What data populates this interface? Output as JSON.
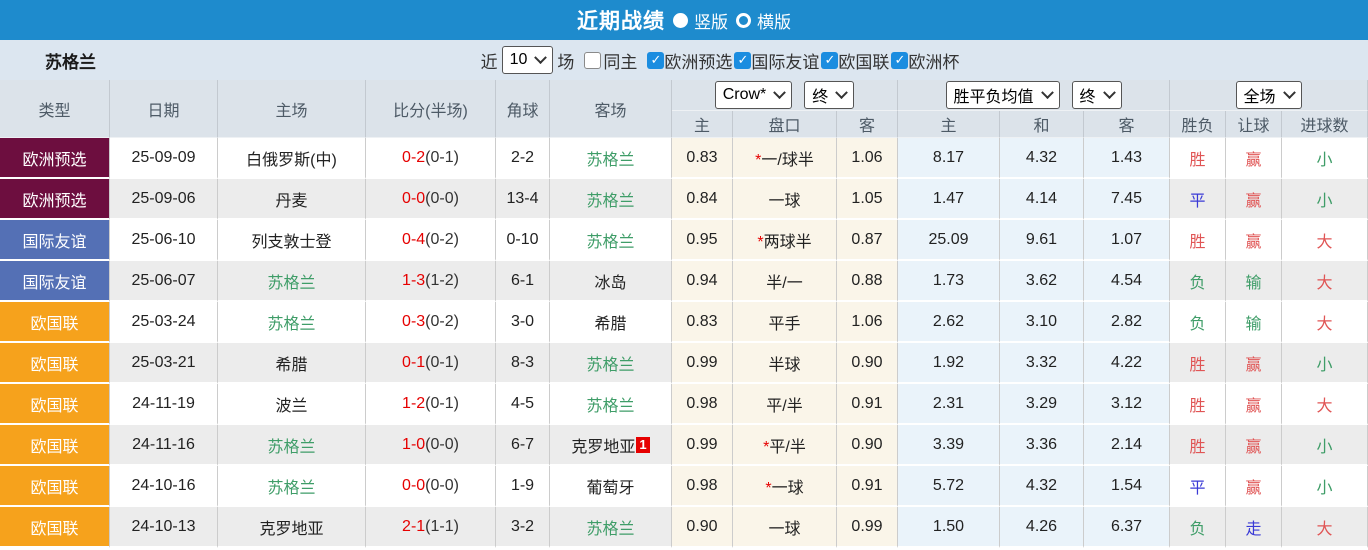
{
  "topbar": {
    "title": "近期战绩",
    "radios": [
      {
        "label": "竖版",
        "selected": true
      },
      {
        "label": "横版",
        "selected": false
      }
    ]
  },
  "filterbar": {
    "team": "苏格兰",
    "recent_label": "近",
    "recent_value": "10",
    "games_label": "场",
    "same_home_label": "同主",
    "same_home_checked": false,
    "competitions": [
      {
        "label": "欧洲预选",
        "checked": true
      },
      {
        "label": "国际友谊",
        "checked": true
      },
      {
        "label": "欧国联",
        "checked": true
      },
      {
        "label": "欧洲杯",
        "checked": true
      }
    ],
    "check_glyph": "✓"
  },
  "table": {
    "headers": {
      "type": "类型",
      "date": "日期",
      "home": "主场",
      "score": "比分(半场)",
      "corner": "角球",
      "away": "客场",
      "odds_select": "Crow*",
      "odds_time_select": "终",
      "odds_sub": [
        "主",
        "盘口",
        "客"
      ],
      "mean_select": "胜平负均值",
      "mean_time_select": "终",
      "mean_sub": [
        "主",
        "和",
        "客"
      ],
      "scope_select": "全场",
      "result_sub": [
        "胜负",
        "让球",
        "进球数"
      ]
    },
    "rows": [
      {
        "type": "欧洲预选",
        "date": "25-09-09",
        "home": "白俄罗斯(中)",
        "home_team": false,
        "score_ft": "0-2",
        "score_ht": "(0-1)",
        "corner": "2-2",
        "away": "苏格兰",
        "away_team": true,
        "away_badge": "",
        "odds_home": "0.83",
        "handicap_star": true,
        "handicap": "一/球半",
        "odds_away": "1.06",
        "mean_home": "8.17",
        "mean_draw": "4.32",
        "mean_away": "1.43",
        "result": "胜",
        "result_color": "red",
        "let_result": "赢",
        "let_color": "red",
        "goals": "小",
        "goals_color": "green"
      },
      {
        "type": "欧洲预选",
        "date": "25-09-06",
        "home": "丹麦",
        "home_team": false,
        "score_ft": "0-0",
        "score_ht": "(0-0)",
        "corner": "13-4",
        "away": "苏格兰",
        "away_team": true,
        "away_badge": "",
        "odds_home": "0.84",
        "handicap_star": false,
        "handicap": "一球",
        "odds_away": "1.05",
        "mean_home": "1.47",
        "mean_draw": "4.14",
        "mean_away": "7.45",
        "result": "平",
        "result_color": "blue",
        "let_result": "赢",
        "let_color": "red",
        "goals": "小",
        "goals_color": "green"
      },
      {
        "type": "国际友谊",
        "date": "25-06-10",
        "home": "列支敦士登",
        "home_team": false,
        "score_ft": "0-4",
        "score_ht": "(0-2)",
        "corner": "0-10",
        "away": "苏格兰",
        "away_team": true,
        "away_badge": "",
        "odds_home": "0.95",
        "handicap_star": true,
        "handicap": "两球半",
        "odds_away": "0.87",
        "mean_home": "25.09",
        "mean_draw": "9.61",
        "mean_away": "1.07",
        "result": "胜",
        "result_color": "red",
        "let_result": "赢",
        "let_color": "red",
        "goals": "大",
        "goals_color": "red"
      },
      {
        "type": "国际友谊",
        "date": "25-06-07",
        "home": "苏格兰",
        "home_team": true,
        "score_ft": "1-3",
        "score_ht": "(1-2)",
        "corner": "6-1",
        "away": "冰岛",
        "away_team": false,
        "away_badge": "",
        "odds_home": "0.94",
        "handicap_star": false,
        "handicap": "半/一",
        "odds_away": "0.88",
        "mean_home": "1.73",
        "mean_draw": "3.62",
        "mean_away": "4.54",
        "result": "负",
        "result_color": "green",
        "let_result": "输",
        "let_color": "green",
        "goals": "大",
        "goals_color": "red"
      },
      {
        "type": "欧国联",
        "date": "25-03-24",
        "home": "苏格兰",
        "home_team": true,
        "score_ft": "0-3",
        "score_ht": "(0-2)",
        "corner": "3-0",
        "away": "希腊",
        "away_team": false,
        "away_badge": "",
        "odds_home": "0.83",
        "handicap_star": false,
        "handicap": "平手",
        "odds_away": "1.06",
        "mean_home": "2.62",
        "mean_draw": "3.10",
        "mean_away": "2.82",
        "result": "负",
        "result_color": "green",
        "let_result": "输",
        "let_color": "green",
        "goals": "大",
        "goals_color": "red"
      },
      {
        "type": "欧国联",
        "date": "25-03-21",
        "home": "希腊",
        "home_team": false,
        "score_ft": "0-1",
        "score_ht": "(0-1)",
        "corner": "8-3",
        "away": "苏格兰",
        "away_team": true,
        "away_badge": "",
        "odds_home": "0.99",
        "handicap_star": false,
        "handicap": "半球",
        "odds_away": "0.90",
        "mean_home": "1.92",
        "mean_draw": "3.32",
        "mean_away": "4.22",
        "result": "胜",
        "result_color": "red",
        "let_result": "赢",
        "let_color": "red",
        "goals": "小",
        "goals_color": "green"
      },
      {
        "type": "欧国联",
        "date": "24-11-19",
        "home": "波兰",
        "home_team": false,
        "score_ft": "1-2",
        "score_ht": "(0-1)",
        "corner": "4-5",
        "away": "苏格兰",
        "away_team": true,
        "away_badge": "",
        "odds_home": "0.98",
        "handicap_star": false,
        "handicap": "平/半",
        "odds_away": "0.91",
        "mean_home": "2.31",
        "mean_draw": "3.29",
        "mean_away": "3.12",
        "result": "胜",
        "result_color": "red",
        "let_result": "赢",
        "let_color": "red",
        "goals": "大",
        "goals_color": "red"
      },
      {
        "type": "欧国联",
        "date": "24-11-16",
        "home": "苏格兰",
        "home_team": true,
        "score_ft": "1-0",
        "score_ht": "(0-0)",
        "corner": "6-7",
        "away": "克罗地亚",
        "away_team": false,
        "away_badge": "1",
        "odds_home": "0.99",
        "handicap_star": true,
        "handicap": "平/半",
        "odds_away": "0.90",
        "mean_home": "3.39",
        "mean_draw": "3.36",
        "mean_away": "2.14",
        "result": "胜",
        "result_color": "red",
        "let_result": "赢",
        "let_color": "red",
        "goals": "小",
        "goals_color": "green"
      },
      {
        "type": "欧国联",
        "date": "24-10-16",
        "home": "苏格兰",
        "home_team": true,
        "score_ft": "0-0",
        "score_ht": "(0-0)",
        "corner": "1-9",
        "away": "葡萄牙",
        "away_team": false,
        "away_badge": "",
        "odds_home": "0.98",
        "handicap_star": true,
        "handicap": "一球",
        "odds_away": "0.91",
        "mean_home": "5.72",
        "mean_draw": "4.32",
        "mean_away": "1.54",
        "result": "平",
        "result_color": "blue",
        "let_result": "赢",
        "let_color": "red",
        "goals": "小",
        "goals_color": "green"
      },
      {
        "type": "欧国联",
        "date": "24-10-13",
        "home": "克罗地亚",
        "home_team": false,
        "score_ft": "2-1",
        "score_ht": "(1-1)",
        "corner": "3-2",
        "away": "苏格兰",
        "away_team": true,
        "away_badge": "",
        "odds_home": "0.90",
        "handicap_star": false,
        "handicap": "一球",
        "odds_away": "0.99",
        "mean_home": "1.50",
        "mean_draw": "4.26",
        "mean_away": "6.37",
        "result": "负",
        "result_color": "green",
        "let_result": "走",
        "let_color": "blue",
        "goals": "大",
        "goals_color": "red"
      }
    ]
  },
  "colors": {
    "topbar_bg": "#1e8bcd",
    "filterbar_bg": "#dce6f0",
    "header_bg": "#dce3ea",
    "row_alt_bg": "#ececec",
    "odds_col_bg": "#faf5e9",
    "mean_col_bg": "#eaf3fa",
    "checkbox_blue": "#1b8de0",
    "score_red": "#e60000",
    "team_green": "#3f9d68",
    "star_red": "#e60000",
    "badge_red": "#e60000",
    "result_red": "#e05555",
    "result_green": "#3f9d68",
    "result_blue": "#3a3ad6",
    "type_colors": {
      "欧洲预选": "#6d0e3f",
      "国际友谊": "#5470b5",
      "欧国联": "#f6a21c"
    }
  }
}
